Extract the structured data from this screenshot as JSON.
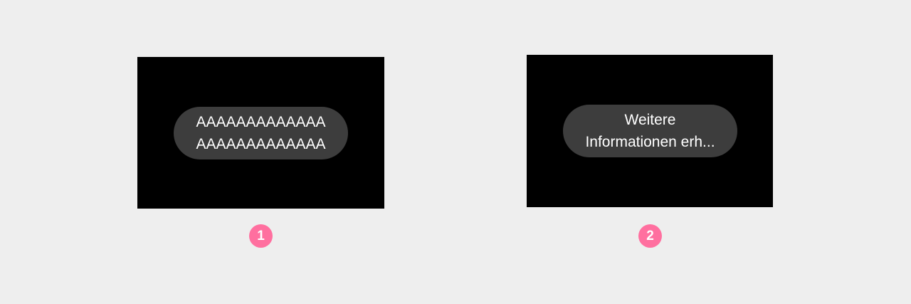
{
  "colors": {
    "page_background": "#eeeeee",
    "screen_background": "#000000",
    "chip_background": "#3d3d3d",
    "chip_text": "#ffffff",
    "marker_background": "#ff6f9f"
  },
  "examples": [
    {
      "marker": "1",
      "chip_lines": [
        "AAAAAAAAAAAAA",
        "AAAAAAAAAAAAA"
      ]
    },
    {
      "marker": "2",
      "chip_lines": [
        "Weitere",
        "Informationen erh..."
      ]
    }
  ]
}
